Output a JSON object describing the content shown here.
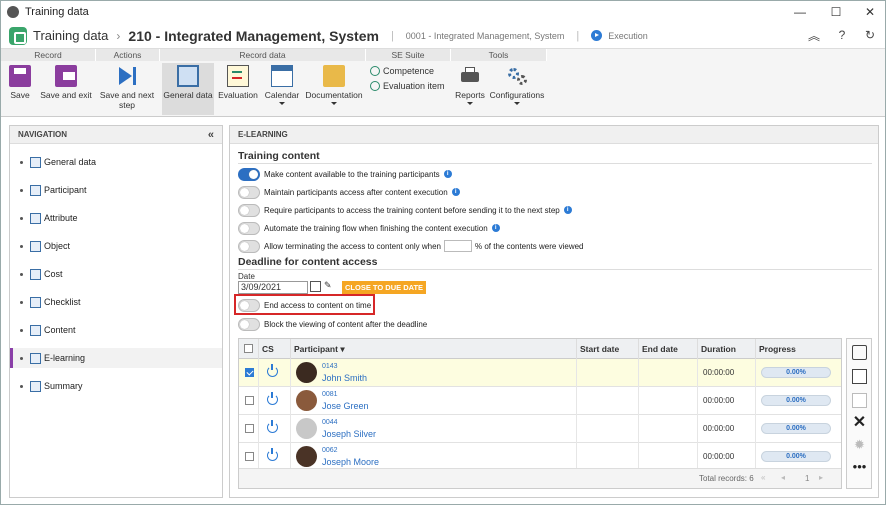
{
  "window": {
    "title": "Training data"
  },
  "header": {
    "module": "Training data",
    "record_title": "210 - Integrated Management, System",
    "record_sub": "0001 - Integrated Management, System",
    "status": "Execution"
  },
  "ribbon": {
    "groups": [
      "Record",
      "Actions",
      "Record data",
      "SE Suite",
      "Tools"
    ],
    "save": "Save",
    "save_exit": "Save and exit",
    "save_next": "Save and next step",
    "general_data": "General data",
    "evaluation": "Evaluation",
    "calendar": "Calendar",
    "documentation": "Documentation",
    "competence": "Competence",
    "evaluation_item": "Evaluation item",
    "reports": "Reports",
    "configurations": "Configurations"
  },
  "nav": {
    "title": "NAVIGATION",
    "items": [
      "General data",
      "Participant",
      "Attribute",
      "Object",
      "Cost",
      "Checklist",
      "Content",
      "E-learning",
      "Summary"
    ],
    "active": "E-learning"
  },
  "main": {
    "title": "E-LEARNING",
    "training_content_title": "Training content",
    "options": [
      {
        "label": "Make content available to the training participants",
        "on": true,
        "info": true
      },
      {
        "label": "Maintain participants access after content execution",
        "on": false,
        "info": true
      },
      {
        "label": "Require participants to access the training content before sending it to the next step",
        "on": false,
        "info": true
      },
      {
        "label": "Automate the training flow when finishing the content execution",
        "on": false,
        "info": true
      }
    ],
    "terminate_before": "Allow terminating the access to content only when",
    "terminate_after": "% of the contents were viewed",
    "deadline_title": "Deadline for content access",
    "date_label": "Date",
    "date_value": "3/09/2021",
    "due_badge": "CLOSE TO DUE DATE",
    "end_access": "End access to content on time",
    "block_view": "Block the viewing of content after the deadline"
  },
  "grid": {
    "columns": [
      "CS",
      "Participant",
      "Start date",
      "End date",
      "Duration",
      "Progress"
    ],
    "rows": [
      {
        "code": "0143",
        "name": "John Smith",
        "duration": "00:00:00",
        "progress": "0.00%",
        "selected": true
      },
      {
        "code": "0081",
        "name": "Jose Green",
        "duration": "00:00:00",
        "progress": "0.00%",
        "selected": false
      },
      {
        "code": "0044",
        "name": "Joseph Silver",
        "duration": "00:00:00",
        "progress": "0.00%",
        "selected": false
      },
      {
        "code": "0062",
        "name": "Joseph Moore",
        "duration": "00:00:00",
        "progress": "0.00%",
        "selected": false
      }
    ],
    "total": "Total records: 6",
    "page": "1"
  }
}
